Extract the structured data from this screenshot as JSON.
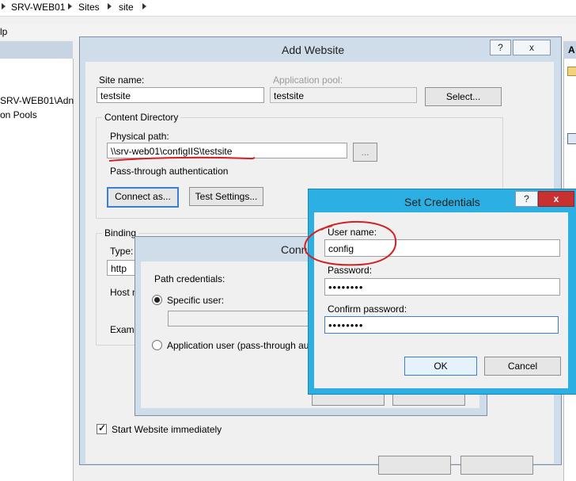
{
  "breadcrumb": {
    "items": [
      "SRV-WEB01",
      "Sites",
      "site"
    ]
  },
  "menubar": {
    "help_fragment": "lp"
  },
  "tree": {
    "server_fragment": "SRV-WEB01\\Adn",
    "app_pools_fragment": "on Pools"
  },
  "right_pane": {
    "header_fragment": "A"
  },
  "add_website": {
    "title": "Add Website",
    "help_btn": "?",
    "close_btn": "x",
    "site_name_label": "Site name:",
    "site_name_value": "testsite",
    "app_pool_label": "Application pool:",
    "app_pool_value": "testsite",
    "select_btn": "Select...",
    "content_dir_label": "Content Directory",
    "physical_path_label": "Physical path:",
    "physical_path_value": "\\\\srv-web01\\configIIS\\testsite",
    "browse_btn": "...",
    "pass_through_label": "Pass-through authentication",
    "connect_as_btn": "Connect as...",
    "test_settings_btn": "Test Settings...",
    "binding_label": "Binding",
    "type_label": "Type:",
    "type_value": "http",
    "host_label_fragment": "Host n",
    "example_fragment": "Examp",
    "start_immediately_label": "Start Website immediately",
    "start_immediately_checked": true
  },
  "connect_as": {
    "title_fragment": "Conn",
    "path_credentials_label": "Path credentials:",
    "specific_user_label": "Specific user:",
    "specific_user_selected": true,
    "app_user_label_fragment": "Application user (pass-through au"
  },
  "set_credentials": {
    "title": "Set Credentials",
    "help_btn": "?",
    "close_btn": "x",
    "user_name_label": "User name:",
    "user_name_value": "config",
    "password_label": "Password:",
    "password_value": "••••••••",
    "confirm_label": "Confirm password:",
    "confirm_value": "••••••••",
    "ok_btn": "OK",
    "cancel_btn": "Cancel"
  },
  "colors": {
    "accent_frame": "#2cb0e3",
    "annotation_red": "#d42020",
    "dialog_frame": "#cfdcea"
  }
}
